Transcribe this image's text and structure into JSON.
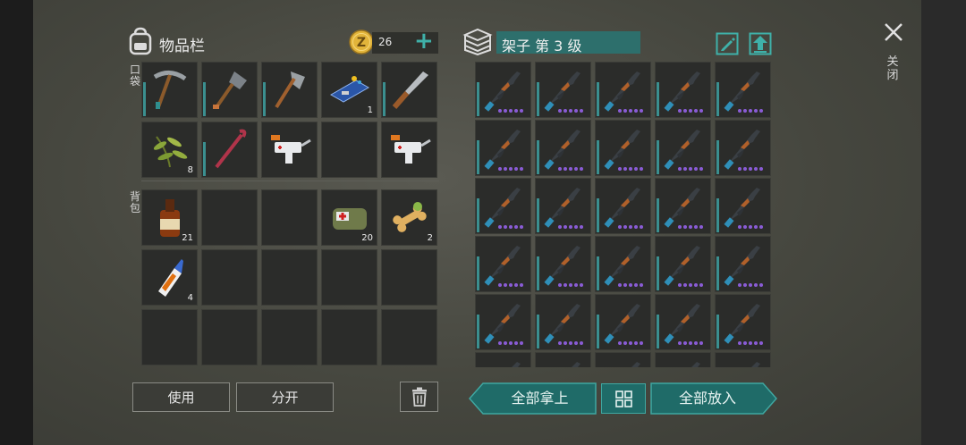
{
  "inventory": {
    "title": "物品栏",
    "coins": "26",
    "pocket_label": "口袋",
    "backpack_label": "背包",
    "pocket_slots": [
      {
        "item": "pickaxe-icon",
        "count": "",
        "bar": true
      },
      {
        "item": "shovel-icon",
        "count": "",
        "bar": true
      },
      {
        "item": "hatchet-icon",
        "count": "",
        "bar": true
      },
      {
        "item": "circuit-board-icon",
        "count": "1",
        "bar": false
      },
      {
        "item": "knife-icon",
        "count": "",
        "bar": true
      },
      {
        "item": "herb-icon",
        "count": "8",
        "bar": false
      },
      {
        "item": "crowbar-icon",
        "count": "",
        "bar": true
      },
      {
        "item": "syringe-gun-icon",
        "count": "",
        "bar": false
      },
      {
        "item": "empty",
        "count": "",
        "bar": false
      },
      {
        "item": "syringe-gun-icon",
        "count": "",
        "bar": false
      }
    ],
    "backpack_slots": [
      {
        "item": "whiskey-bottle-icon",
        "count": "21"
      },
      {
        "item": "empty",
        "count": ""
      },
      {
        "item": "empty",
        "count": ""
      },
      {
        "item": "medkit-bag-icon",
        "count": "20"
      },
      {
        "item": "dog-bone-icon",
        "count": "2"
      },
      {
        "item": "glue-bottle-icon",
        "count": "4"
      },
      {
        "item": "empty",
        "count": ""
      },
      {
        "item": "empty",
        "count": ""
      },
      {
        "item": "empty",
        "count": ""
      },
      {
        "item": "empty",
        "count": ""
      },
      {
        "item": "empty",
        "count": ""
      },
      {
        "item": "empty",
        "count": ""
      },
      {
        "item": "empty",
        "count": ""
      },
      {
        "item": "empty",
        "count": ""
      },
      {
        "item": "empty",
        "count": ""
      }
    ]
  },
  "storage": {
    "title": "架子 第 3 级",
    "rifle_rows": 6,
    "rifle_cols": 5,
    "rifle_item": "assault-rifle-icon"
  },
  "buttons": {
    "use": "使用",
    "split": "分开",
    "take_all": "全部拿上",
    "put_all": "全部放入",
    "close": "关闭"
  },
  "colors": {
    "teal": "#1f6b68",
    "teal_light": "#3fa7a1",
    "durability": "#3b8f8f",
    "mod_dots": "#8a5cd6",
    "coin": "#e2b43a"
  }
}
